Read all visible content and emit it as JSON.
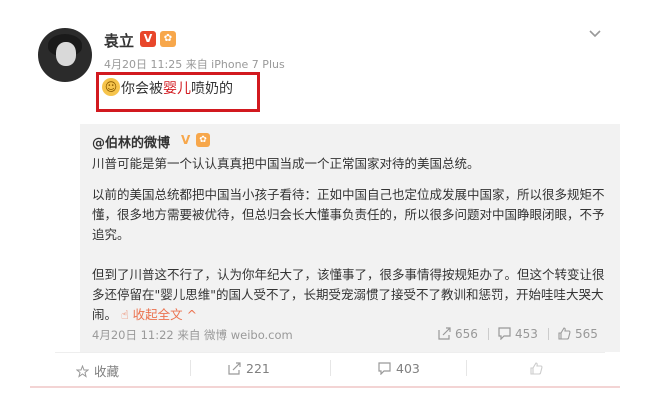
{
  "post": {
    "username": "袁立",
    "v_badge": "V",
    "timestamp": "4月20日 11:25 来自 iPhone 7 Plus",
    "text_before": "你会被",
    "text_highlight": "婴儿",
    "text_after": "喷奶的"
  },
  "repost": {
    "username": "@伯林的微博",
    "lines": [
      "川普可能是第一个认认真真把中国当成一个正常国家对待的美国总统。",
      "以前的美国总统都把中国当小孩子看待：正如中国自己也定位成发展中国家，所以很多规矩不",
      "懂，很多地方需要被优待，但总归会长大懂事负责任的，所以很多问题对中国睁眼闭眼，不予",
      "追究。",
      "但到了川普这不行了，认为你年纪大了，该懂事了，很多事情得按规矩办了。但这个转变让很",
      "多还停留在\"婴儿思维\"的国人受不了，长期受宠溺惯了接受不了教训和惩罚，开始哇哇大哭大",
      "闹。"
    ],
    "collapse_link": "收起全文 ^",
    "meta": "4月20日 11:22 来自 微博 weibo.com",
    "shares": "656",
    "comments": "453",
    "likes": "565"
  },
  "footer": {
    "favorite": "收藏",
    "share_count": "221",
    "comment_count": "403"
  },
  "colors": {
    "highlight_box": "#d2191f",
    "link": "#eb7350",
    "repost_bg": "#f2f2f2"
  }
}
